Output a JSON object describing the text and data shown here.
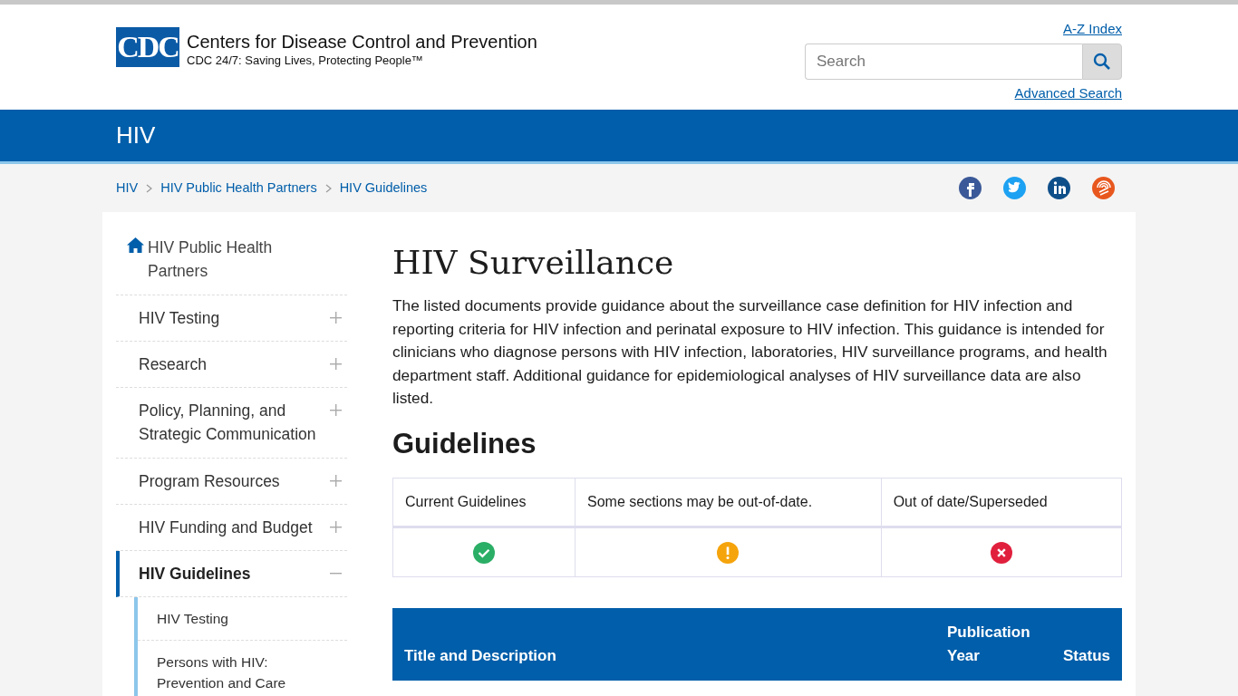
{
  "header": {
    "logo": {
      "mark": "CDC",
      "title": "Centers for Disease Control and Prevention",
      "tagline": "CDC 24/7: Saving Lives, Protecting People™"
    },
    "az_link": "A-Z Index",
    "search": {
      "placeholder": "Search"
    },
    "advanced_link": "Advanced Search"
  },
  "site_title": "HIV",
  "breadcrumbs": [
    "HIV",
    "HIV Public Health Partners",
    "HIV Guidelines"
  ],
  "social": [
    {
      "kind": "facebook"
    },
    {
      "kind": "twitter"
    },
    {
      "kind": "linkedin"
    },
    {
      "kind": "syndicate"
    }
  ],
  "sidebar": {
    "items": [
      {
        "kind": "home",
        "label": "HIV Public Health Partners",
        "selected": false
      },
      {
        "kind": "section",
        "label": "HIV Testing",
        "expanded": false,
        "selected": false
      },
      {
        "kind": "section",
        "label": "Research",
        "expanded": false,
        "selected": false
      },
      {
        "kind": "section",
        "label": "Policy, Planning, and Strategic Communication",
        "expanded": false,
        "selected": false
      },
      {
        "kind": "section",
        "label": "Program Resources",
        "expanded": false,
        "selected": false
      },
      {
        "kind": "section",
        "label": "HIV Funding and Budget",
        "expanded": false,
        "selected": false
      },
      {
        "kind": "section",
        "label": "HIV Guidelines",
        "expanded": true,
        "selected": true,
        "children": [
          {
            "label": "HIV Testing",
            "selected": false
          },
          {
            "label": "Persons with HIV: Prevention and Care",
            "selected": false
          }
        ]
      }
    ]
  },
  "page_title": "HIV Surveillance",
  "intro": "The listed documents provide guidance about the surveillance case definition for HIV infection and reporting criteria for HIV infection and perinatal exposure to HIV infection. This guidance is intended for clinicians who diagnose persons with HIV infection, laboratories, HIV surveillance programs, and health department staff. Additional guidance for epidemiological analyses of HIV surveillance data are also listed.",
  "section_title": "Guidelines",
  "legend": [
    {
      "label": "Current Guidelines",
      "kind": "current"
    },
    {
      "label": "Some sections may be out-of-date.",
      "kind": "partial"
    },
    {
      "label": "Out of date/Superseded",
      "kind": "superseded"
    }
  ],
  "table": {
    "columns": [
      "Title and Description",
      "Publication Year",
      "Status"
    ]
  }
}
